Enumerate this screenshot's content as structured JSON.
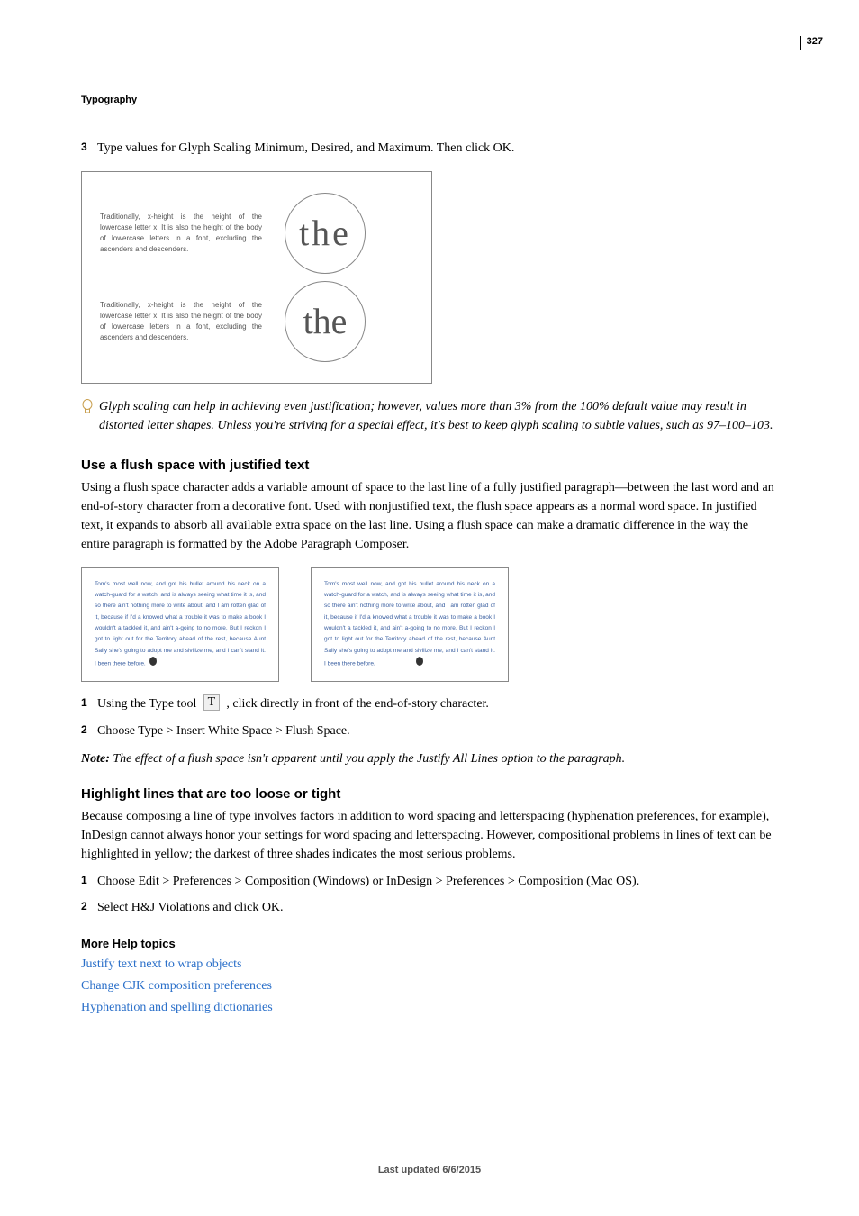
{
  "page_number": "327",
  "header": "Typography",
  "step3": {
    "num": "3",
    "text": "Type values for Glyph Scaling Minimum, Desired, and Maximum. Then click OK."
  },
  "fig1": {
    "block_a": "Traditionally, x-height is the height of the lowercase letter x. It is also the height of the body of lowercase letters in a font, excluding the ascenders and descenders.",
    "block_b": "Traditionally, x-height is the height of the lowercase letter x. It is also the height of the body of lowercase letters in a font, excluding the ascenders and descenders.",
    "circle_a": "the",
    "circle_b": "the"
  },
  "bulb_note": "Glyph scaling can help in achieving even justification; however, values more than 3% from the 100% default value may result in distorted letter shapes. Unless you're striving for a special effect, it's best to keep glyph scaling to subtle values, such as 97–100–103.",
  "section_a": {
    "heading": "Use a flush space with justified text",
    "p1": "Using a flush space character adds a variable amount of space to the last line of a fully justified paragraph—between the last word and an end-of-story character from a decorative font. Used with nonjustified text, the flush space appears as a normal word space. In justified text, it expands to absorb all available extra space on the last line. Using a flush space can make a dramatic difference in the way the entire paragraph is formatted by the Adobe Paragraph Composer."
  },
  "columns": {
    "left": "Tom's most well now, and got his bullet around his neck on a watch-guard for a watch, and is always seeing what time it is, and so there ain't nothing more to write about, and I am rotten glad of it, because if I'd a knowed what a trouble it was to make a book I wouldn't a tackled it, and ain't a-going to no more. But I reckon I got to light out for the Territory ahead of the rest, because Aunt Sally she's going to adopt me and sivilize me, and I can't stand it. I been there before.",
    "right": "Tom's most well now, and got his bullet around his neck on a watch-guard for a watch, and is always seeing what time it is, and so there ain't nothing more to write about, and I am rotten glad of it, because if I'd a knowed what a trouble it was to make a book I wouldn't a tackled it, and ain't a-going to no more. But I reckon I got to light out for the Territory ahead of the rest, because Aunt Sally she's going to adopt me and sivilize me, and I can't stand it. I been there before."
  },
  "steps_a": {
    "s1": {
      "num": "1",
      "pre": "Using the Type tool ",
      "icon": "T",
      "post": " , click directly in front of the end-of-story character."
    },
    "s2": {
      "num": "2",
      "text": "Choose Type > Insert White Space > Flush Space."
    }
  },
  "note1": {
    "label": "Note:",
    "body": " The effect of a flush space isn't apparent until you apply the Justify All Lines option to the paragraph."
  },
  "section_b": {
    "heading": "Highlight lines that are too loose or tight",
    "p1": "Because composing a line of type involves factors in addition to word spacing and letterspacing (hyphenation preferences, for example), InDesign cannot always honor your settings for word spacing and letterspacing. However, compositional problems in lines of text can be highlighted in yellow; the darkest of three shades indicates the most serious problems."
  },
  "steps_b": {
    "s1": {
      "num": "1",
      "text": "Choose Edit > Preferences > Composition (Windows) or InDesign > Preferences > Composition (Mac OS)."
    },
    "s2": {
      "num": "2",
      "text": "Select H&J Violations and click OK."
    }
  },
  "more_help": {
    "heading": "More Help topics",
    "links": [
      "Justify text next to wrap objects",
      "Change CJK composition preferences",
      "Hyphenation and spelling dictionaries"
    ]
  },
  "footer": "Last updated 6/6/2015"
}
